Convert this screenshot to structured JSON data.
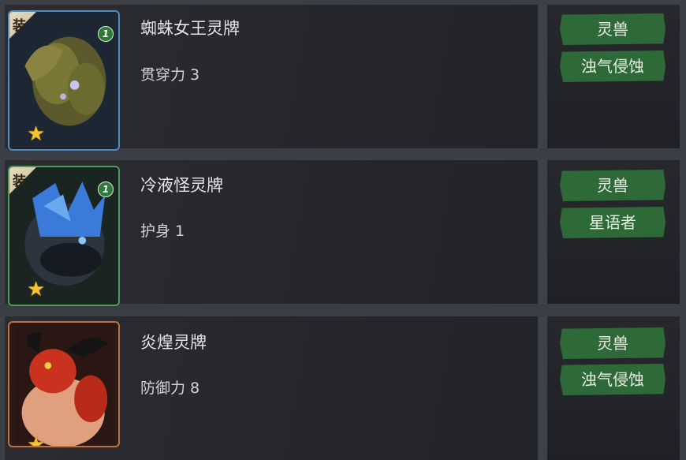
{
  "cards": [
    {
      "equip_badge": "装",
      "level": "1",
      "frame_color": "#4f8cc0",
      "name": "蜘蛛女王灵牌",
      "stat": "贯穿力 3",
      "tags": [
        "灵兽",
        "浊气侵蚀"
      ],
      "art_icon": "spider-queen-art",
      "stars": 1
    },
    {
      "equip_badge": "装",
      "level": "1",
      "frame_color": "#4c9a5e",
      "name": "冷液怪灵牌",
      "stat": "护身 1",
      "tags": [
        "灵兽",
        "星语者"
      ],
      "art_icon": "frost-beast-art",
      "stars": 1
    },
    {
      "equip_badge": "",
      "level": "",
      "frame_color": "#c0703e",
      "name": "炎煌灵牌",
      "stat": "防御力 8",
      "tags": [
        "灵兽",
        "浊气侵蚀"
      ],
      "art_icon": "flame-demon-art",
      "stars": 1
    }
  ],
  "colors": {
    "tag_bg": "#2e6a38",
    "star": "#f2c431"
  }
}
